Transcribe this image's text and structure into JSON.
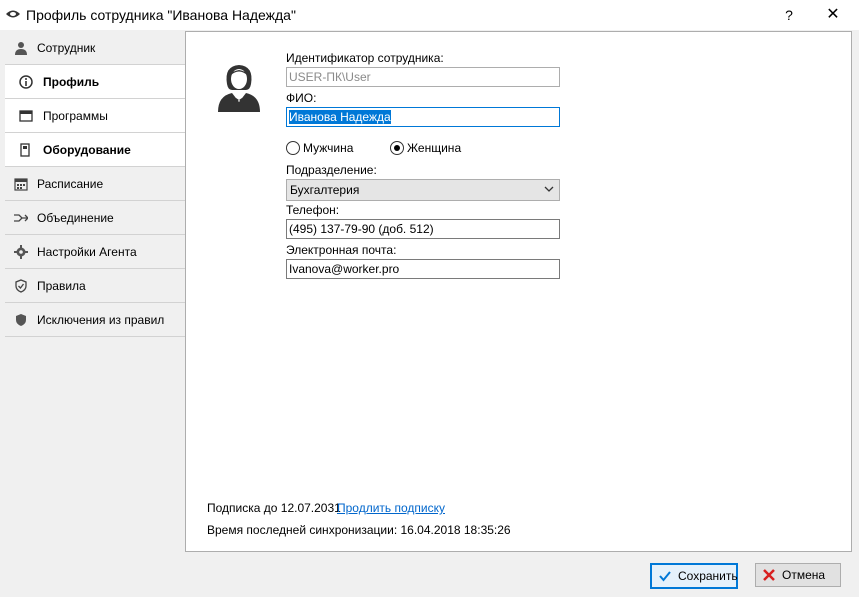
{
  "window": {
    "title": "Профиль сотрудника \"Иванова Надежда\"",
    "help_label": "?",
    "close_label": "✕"
  },
  "sidebar": {
    "items": [
      {
        "label": "Сотрудник",
        "icon": "person-icon"
      },
      {
        "label": "Профиль",
        "icon": "info-icon"
      },
      {
        "label": "Программы",
        "icon": "window-icon"
      },
      {
        "label": "Оборудование",
        "icon": "device-icon"
      },
      {
        "label": "Расписание",
        "icon": "calendar-icon"
      },
      {
        "label": "Объединение",
        "icon": "merge-icon"
      },
      {
        "label": "Настройки Агента",
        "icon": "gear-icon"
      },
      {
        "label": "Правила",
        "icon": "shield-check-icon"
      },
      {
        "label": "Исключения из правил",
        "icon": "shield-icon"
      }
    ]
  },
  "form": {
    "id_label": "Идентификатор сотрудника:",
    "id_value": "USER-ПК\\User",
    "name_label": "ФИО:",
    "name_value": "Иванова Надежда",
    "gender_male": "Мужчина",
    "gender_female": "Женщина",
    "gender_selected": "female",
    "dept_label": "Подразделение:",
    "dept_value": "Бухгалтерия",
    "phone_label": "Телефон:",
    "phone_value": "(495) 137-79-90  (доб. 512)",
    "email_label": "Электронная почта:",
    "email_value": "Ivanova@worker.pro"
  },
  "footer": {
    "subscription": "Подписка до 12.07.2031",
    "renew_link": "Продлить подписку",
    "last_sync": "Время последней синхронизации: 16.04.2018 18:35:26"
  },
  "buttons": {
    "save": "Сохранить",
    "cancel": "Отмена"
  },
  "colors": {
    "accent": "#0078d7",
    "link": "#0066cc",
    "cancel_x": "#d82020"
  }
}
